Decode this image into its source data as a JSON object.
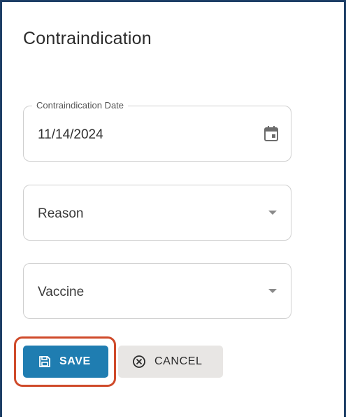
{
  "dialog": {
    "title": "Contraindication"
  },
  "fields": {
    "date": {
      "label": "Contraindication Date",
      "value": "11/14/2024",
      "icon": "calendar-icon"
    },
    "reason": {
      "placeholder": "Reason",
      "icon": "chevron-down-icon"
    },
    "vaccine": {
      "placeholder": "Vaccine",
      "icon": "chevron-down-icon"
    }
  },
  "actions": {
    "save_label": "SAVE",
    "save_icon": "floppy-disk-icon",
    "cancel_label": "CANCEL",
    "cancel_icon": "x-circle-icon"
  },
  "colors": {
    "primary": "#1f7db1",
    "secondary_button": "#e8e6e4",
    "highlight": "#cf4a2a",
    "frame": "#1d3e66"
  }
}
